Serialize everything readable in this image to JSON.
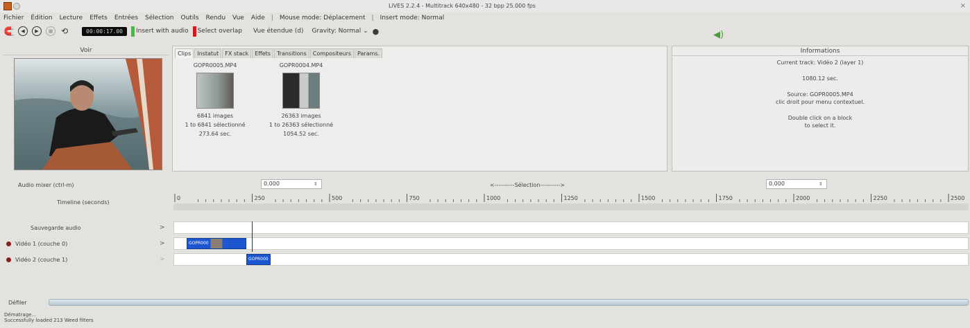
{
  "window": {
    "title": "LiVES 2.2.4 - Multitrack 640x480 - 32 bpp 25.000 fps",
    "close": "×"
  },
  "menu": {
    "items": [
      "Fichier",
      "Édition",
      "Lecture",
      "Effets",
      "Entrées",
      "Sélection",
      "Outils",
      "Rendu",
      "Vue",
      "Aide",
      "|",
      "Mouse mode: Déplacement",
      "|",
      "Insert mode: Normal"
    ]
  },
  "toolbar": {
    "time": "00:00:17.00",
    "insert_with_audio": "Insert with audio",
    "select_overlap": "Select overlap",
    "vue_etendue": "Vue étendue (d)",
    "gravity": "Gravity: Normal",
    "gravity_arrow": "⌄",
    "colors": {
      "green_mark": "#3fbf3f",
      "red_mark": "#d11a1a"
    }
  },
  "voir": {
    "title": "Voir"
  },
  "clips_tabs": [
    "Clips",
    "Instatut",
    "FX stack",
    "Effets",
    "Transitions",
    "Compositeurs",
    "Params."
  ],
  "clips": [
    {
      "name": "GOPR0005.MP4",
      "images": "6841 images",
      "selection": "1 to 6841 sélectionné",
      "duration": "273.64 sec."
    },
    {
      "name": "GOPR0004.MP4",
      "images": "26363 images",
      "selection": "1 to 26363 sélectionné",
      "duration": "1054.52 sec."
    }
  ],
  "info": {
    "title": "Informations",
    "track": "Current track: Vidéo 2 (layer 1)",
    "time": "1080.12 sec.",
    "source": "Source: GOPR0005.MP4",
    "hint": "clic droit pour menu contextuel.",
    "dbl1": "Double click on a block",
    "dbl2": "to select it."
  },
  "timeline": {
    "audio_mixer": "Audio mixer (ctrl-m)",
    "selection_label": "<----------Sélection---------->",
    "start_value": "0.000",
    "end_value": "0.000",
    "spin_glyph": "⇕",
    "timeline_label": "Timeline (seconds)",
    "ruler": [
      "0",
      "250",
      "500",
      "750",
      "1000",
      "1250",
      "1500",
      "1750",
      "2000",
      "2250",
      "2500"
    ],
    "tracks": [
      {
        "label": "Sauvegarde audio",
        "chev": ">"
      },
      {
        "label": "Vidéo 1 (couche 0)",
        "chev": ">"
      },
      {
        "label": "Vidéo 2 (couche 1)",
        "chev": ">"
      }
    ],
    "blocks": [
      "GOPR000",
      "GOPR000"
    ],
    "scroll_label": "Défiler"
  },
  "status": {
    "line1": "Dématrage...",
    "line2": "Successfully loaded 213 Weed filters"
  }
}
